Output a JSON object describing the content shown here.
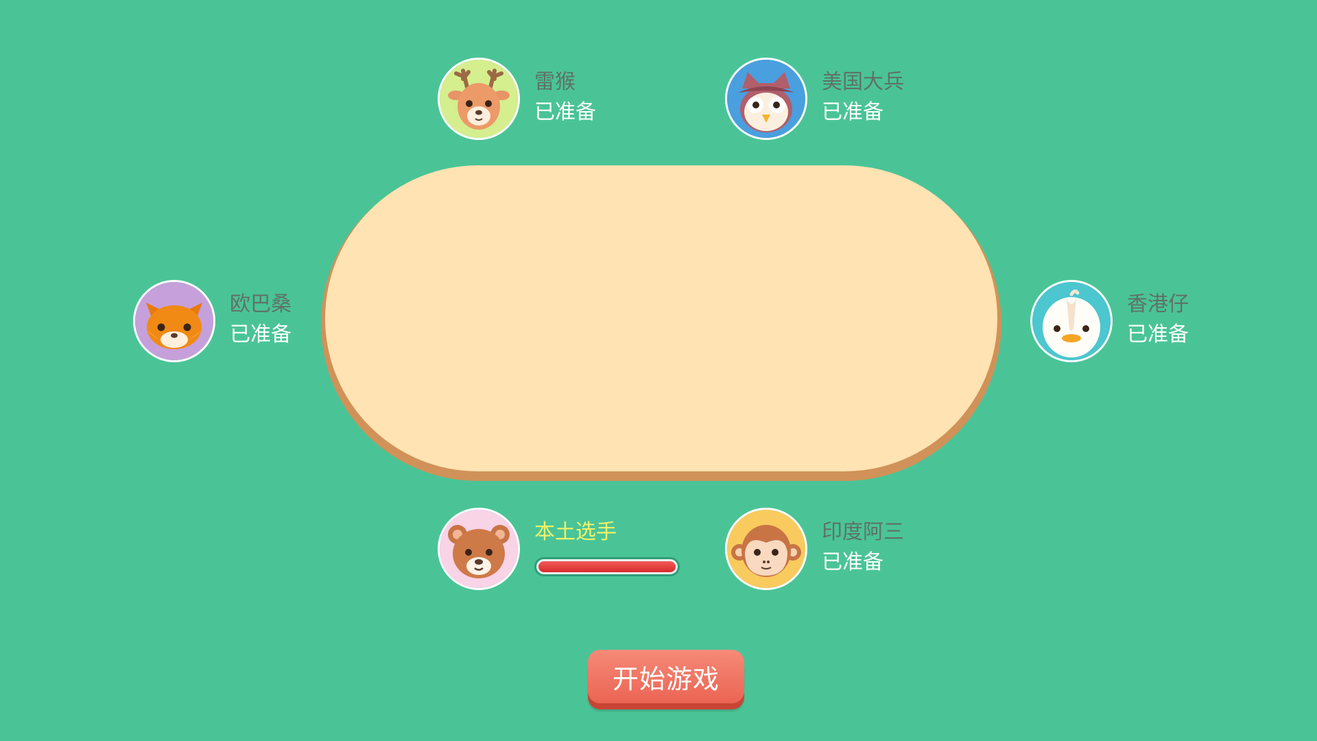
{
  "button": {
    "start_label": "开始游戏"
  },
  "players": [
    {
      "name": "雷猴",
      "status": "已准备",
      "avatar_icon": "deer-icon",
      "avatar_bg": "#D5EE8E"
    },
    {
      "name": "美国大兵",
      "status": "已准备",
      "avatar_icon": "owl-icon",
      "avatar_bg": "#4A9FDF"
    },
    {
      "name": "欧巴桑",
      "status": "已准备",
      "avatar_icon": "fox-icon",
      "avatar_bg": "#C6A0DA"
    },
    {
      "name": "香港仔",
      "status": "已准备",
      "avatar_icon": "duck-icon",
      "avatar_bg": "#4CC6CF"
    },
    {
      "name": "本土选手",
      "status": "",
      "avatar_icon": "bear-icon",
      "avatar_bg": "#F9D3E6",
      "progress": 1.0
    },
    {
      "name": "印度阿三",
      "status": "已准备",
      "avatar_icon": "monkey-icon",
      "avatar_bg": "#F9CB5E"
    }
  ],
  "colors": {
    "background": "#4AC497",
    "table": "#FFE3B2",
    "table_rim": "#D09258",
    "button": "#EF6F5E"
  }
}
